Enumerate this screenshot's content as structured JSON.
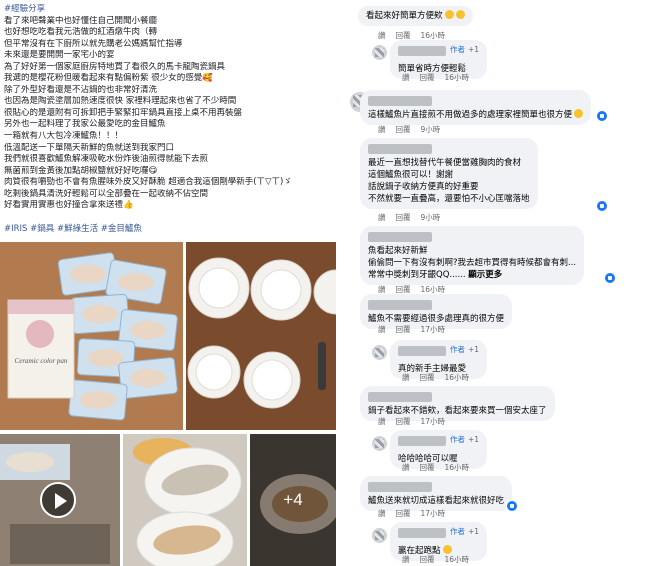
{
  "post": {
    "lines": [
      "#經驗分享",
      "看了來吧聲業中也好懂住自己開聞小餐廳",
      "也好想吃吃看我元浩做的紅酒燉牛肉（轉",
      "但平常沒有在下廚所以就先購老公媽媽幫忙指導",
      "未來還是要開開一家宅小的宴",
      "為了好好第一個家庭廚房特地買了看很久的馬卡龍陶瓷鍋具",
      "我選的是櫻花粉但暖看起來有點偏粉紫 很少女的感覺🥰",
      "除了外型好看還是不沾鍋的也非常好清洗",
      "也因為是陶瓷塗層加熱速度很快 家裡料理起來也省了不少時間",
      "很貼心的是還附有可拆卸把手緊緊扣牢鍋具直接上桌不用再裝盤",
      "另外也一起料理了我家公最愛吃的金目鱸魚",
      "一箱就有八大包冷凍鱸魚！！！",
      "低溫配送一下單隔天新鮮的魚就送到我家門口",
      "我們就很喜歡鱸魚解凍吸乾水份炸後油煎得就能下去煎",
      "無菌煎到金黃後加點胡椒鹽就好好吃囉😋",
      "肉質很有嚼勁也不會有魚腥味外皮又好酥脆 超適合我這個剛學新手(ㄒ▽ㄒ)ゞ",
      "吃剩後鍋具清洗好輕鬆可以全部疊在一起收納不佔空間",
      "好看實用實惠也好撞合拿來送禮👍"
    ],
    "tags": "#IRIS #鍋具 #鮮綠生活 #金目鱸魚",
    "photos": {
      "product_box_title": "Ceramic color pan",
      "more_count": "+4"
    }
  },
  "comments": [
    {
      "text": "看起來好簡單方便欸",
      "likes": "",
      "time": "16小時",
      "like_label": "讚",
      "reply_label": "回覆"
    },
    {
      "author_badge": "作者",
      "plus": "+1",
      "text": "簡單省時方便輕鬆",
      "time": "16小時",
      "like_label": "讚",
      "reply_label": "回覆"
    },
    {
      "text": "這樣鱸魚片直接煎不用做過多的處理家裡簡單也很方便",
      "time": "9小時",
      "like_label": "讚",
      "reply_label": "回覆"
    },
    {
      "text_lines": [
        "最近一直想找替代午餐便當雞胸肉的食材",
        "這個鱸魚很可以！謝謝",
        "話說鍋子收納方便真的好重要",
        "不然就要一直疊高，還要怕不小心匡噹落地"
      ],
      "time": "9小時",
      "like_label": "讚",
      "reply_label": "回覆"
    },
    {
      "text_lines": [
        "魚看起來好新鮮",
        "偷偷問一下有沒有刺啊?我去超市買得有時候都會有刺...",
        "常常中獎刺到牙齦QQ......"
      ],
      "more_label": "顯示更多",
      "time": "16小時",
      "like_label": "讚",
      "reply_label": "回覆"
    },
    {
      "text": "鱸魚不需要經過很多處理真的很方便",
      "time": "17小時",
      "like_label": "讚",
      "reply_label": "回覆"
    },
    {
      "author_badge": "作者",
      "plus": "+1",
      "text": "真的新手主婦最愛",
      "time": "16小時",
      "like_label": "讚",
      "reply_label": "回覆"
    },
    {
      "text": "鍋子看起來不錯欸，看起來要來買一個安太座了",
      "time": "17小時",
      "like_label": "讚",
      "reply_label": "回覆"
    },
    {
      "author_badge": "作者",
      "plus": "+1",
      "text": "哈哈哈哈可以喔",
      "time": "16小時",
      "like_label": "讚",
      "reply_label": "回覆"
    },
    {
      "text": "鱸魚送來就切成這樣看起來就很好吃",
      "time": "17小時",
      "like_label": "讚",
      "reply_label": "回覆"
    },
    {
      "author_badge": "作者",
      "plus": "+1",
      "text": "贏在起跑點",
      "time": "16小時",
      "like_label": "讚",
      "reply_label": "回覆"
    }
  ],
  "colors": {
    "bubble": "#f0f2f5",
    "link": "#385898",
    "author_badge": "#216fdb",
    "meta": "#65676b"
  }
}
